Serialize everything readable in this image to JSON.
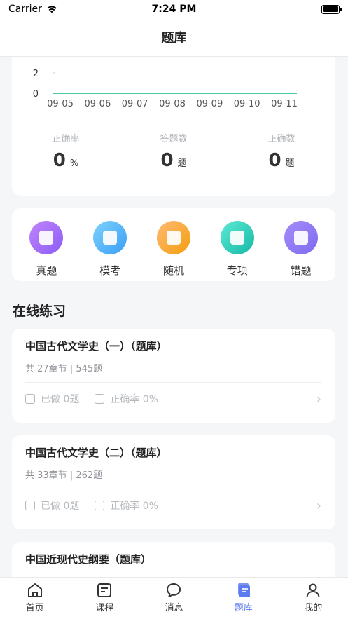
{
  "status": {
    "carrier": "Carrier",
    "time": "7:24 PM"
  },
  "nav": {
    "title": "题库"
  },
  "chart_data": {
    "type": "line",
    "x": [
      "09-05",
      "09-06",
      "09-07",
      "09-08",
      "09-09",
      "09-10",
      "09-11"
    ],
    "series": [
      {
        "values": [
          0,
          0,
          0,
          0,
          0,
          0,
          0
        ]
      }
    ],
    "yticks": [
      0,
      2,
      4
    ],
    "ylim": [
      0,
      4
    ],
    "color": "#4cc9a4"
  },
  "stats": [
    {
      "label": "正确率",
      "value": "0",
      "unit": "%"
    },
    {
      "label": "答题数",
      "value": "0",
      "unit": "题"
    },
    {
      "label": "正确数",
      "value": "0",
      "unit": "题"
    }
  ],
  "categories": [
    {
      "label": "真题",
      "color_a": "#c084fc",
      "color_b": "#8b5cf6"
    },
    {
      "label": "模考",
      "color_a": "#7dd3fc",
      "color_b": "#3b9ef5"
    },
    {
      "label": "随机",
      "color_a": "#fdba74",
      "color_b": "#f59e0b"
    },
    {
      "label": "专项",
      "color_a": "#5eead4",
      "color_b": "#14b8a6"
    },
    {
      "label": "错题",
      "color_a": "#a78bfa",
      "color_b": "#7c6cf0"
    }
  ],
  "section_title": "在线练习",
  "courses": [
    {
      "title": "中国古代文学史（一）（题库）",
      "meta": "共 27章节 | 545题",
      "done": "已做 0题",
      "accuracy": "正确率 0%"
    },
    {
      "title": "中国古代文学史（二）（题库）",
      "meta": "共 33章节 | 262题",
      "done": "已做 0题",
      "accuracy": "正确率 0%"
    },
    {
      "title": "中国近现代史纲要（题库）",
      "meta": "",
      "done": "",
      "accuracy": ""
    }
  ],
  "tabs": [
    {
      "label": "首页"
    },
    {
      "label": "课程"
    },
    {
      "label": "消息"
    },
    {
      "label": "题库"
    },
    {
      "label": "我的"
    }
  ],
  "active_tab_color": "#5d7cf0"
}
